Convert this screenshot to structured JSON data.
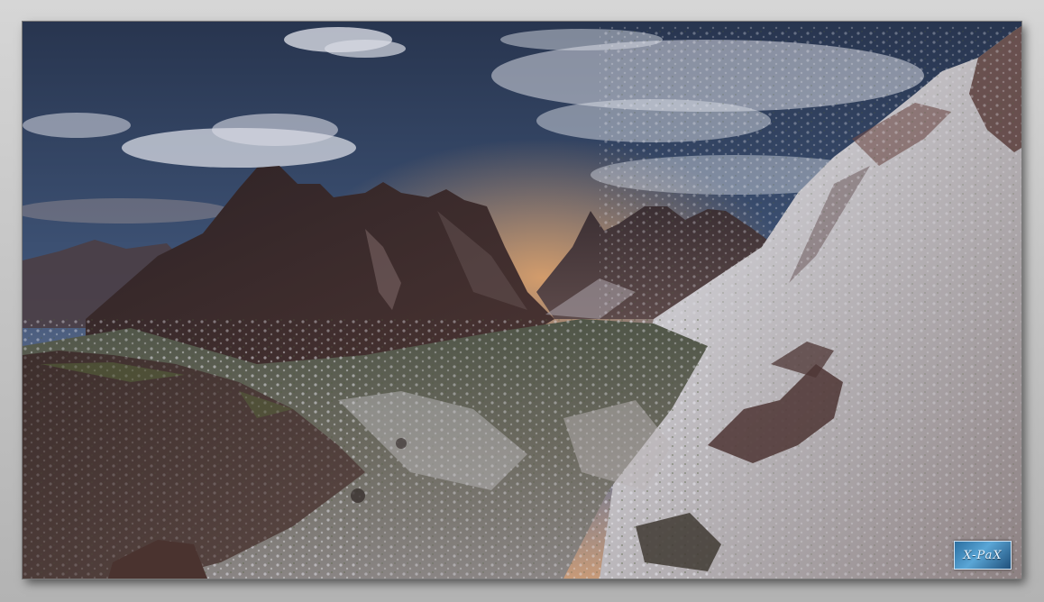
{
  "scene": {
    "description_icon": "mountain-valley-landscape",
    "colors": {
      "sky_top": "#2c3a55",
      "sky_mid": "#41577a",
      "horizon_glow": "#d9a070",
      "peak_dark": "#3a2a2a",
      "rock_red": "#5c3b34",
      "snow": "#cfcfd4",
      "moss": "#5c6a3c",
      "frame_bg": "#c8c8c8"
    }
  },
  "watermark": {
    "text": "X-PaX",
    "icon": "xpax-logo-icon"
  }
}
